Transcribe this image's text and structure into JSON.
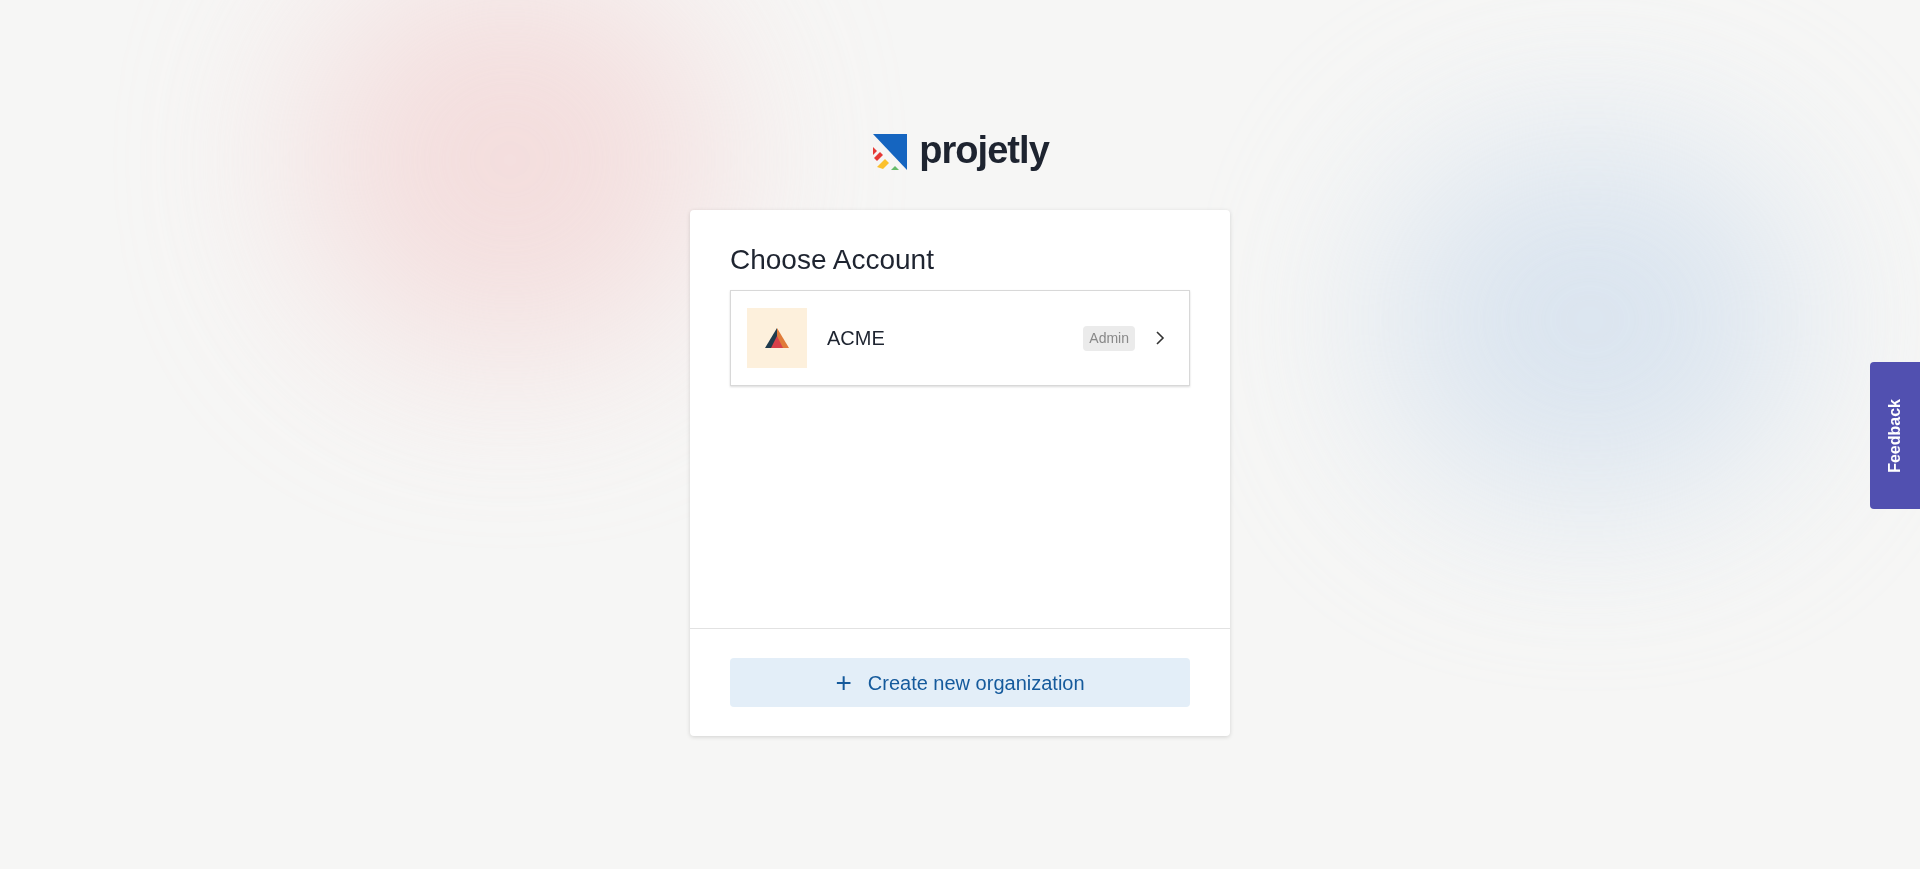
{
  "logo": {
    "text": "projetly"
  },
  "card": {
    "title": "Choose Account",
    "accounts": [
      {
        "name": "ACME",
        "role": "Admin"
      }
    ],
    "create_button": {
      "label": "Create new organization",
      "icon": "+"
    }
  },
  "feedback_tab": {
    "label": "Feedback"
  }
}
